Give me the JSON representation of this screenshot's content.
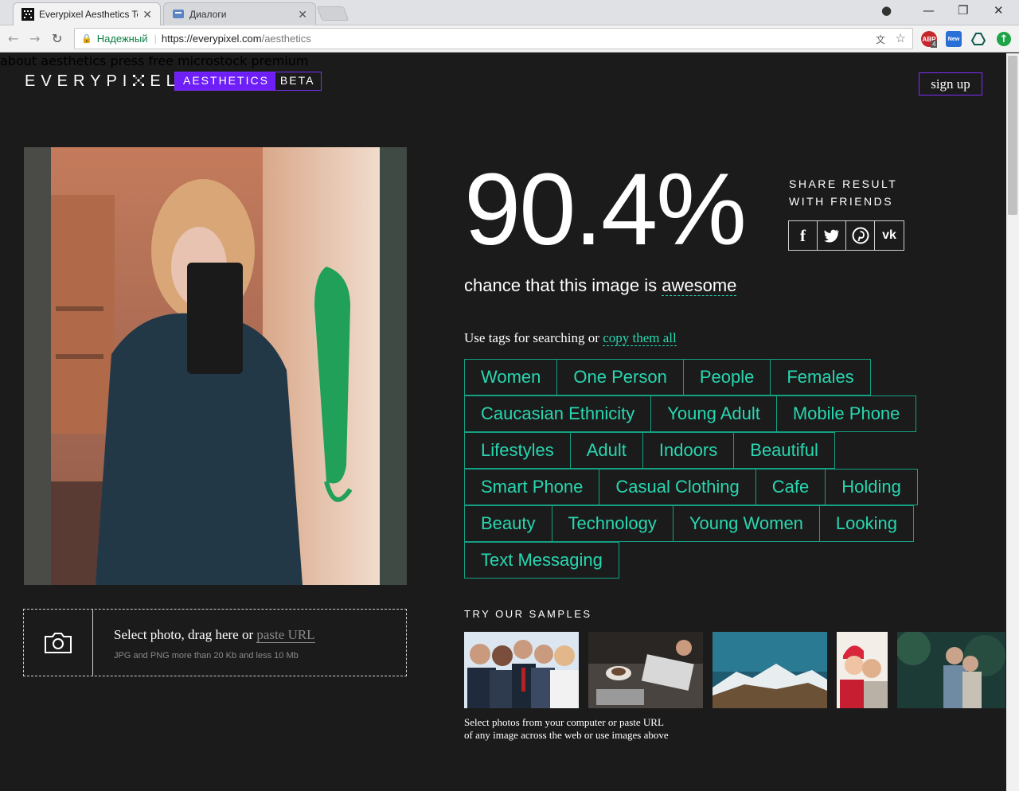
{
  "browser": {
    "tabs": [
      {
        "title": "Everypixel Aesthetics Tes",
        "active": true
      },
      {
        "title": "Диалоги",
        "active": false
      }
    ],
    "address": {
      "secure_label": "Надежный",
      "url_host": "https://everypixel.com",
      "url_path": "/aesthetics"
    },
    "extensions": [
      {
        "name": "adblock-icon",
        "label": "ABP",
        "badge": "4"
      },
      {
        "name": "new-extension-icon",
        "label": "New"
      }
    ]
  },
  "header": {
    "logo_left": "EVERYPI",
    "logo_right": "EL",
    "badge_main": "AESTHETICS",
    "badge_beta": "BETA",
    "nav": [
      "about",
      "aesthetics",
      "press",
      "free",
      "microstock",
      "premium"
    ],
    "signup": "sign up"
  },
  "result": {
    "score": "90.4%",
    "share_line1": "SHARE RESULT",
    "share_line2": "WITH FRIENDS",
    "social": [
      {
        "name": "facebook-icon",
        "glyph": "f"
      },
      {
        "name": "twitter-icon",
        "glyph": "t"
      },
      {
        "name": "pinterest-icon",
        "glyph": "p"
      },
      {
        "name": "vk-icon",
        "glyph": "vk"
      }
    ],
    "chance_prefix": "chance that this image is",
    "chance_word": "awesome"
  },
  "tags_section": {
    "intro": "Use tags for searching or",
    "copy_link": "copy them all",
    "rows": [
      [
        "Women",
        "One Person",
        "People",
        "Females"
      ],
      [
        "Caucasian Ethnicity",
        "Young Adult",
        "Mobile Phone"
      ],
      [
        "Lifestyles",
        "Adult",
        "Indoors",
        "Beautiful"
      ],
      [
        "Smart Phone",
        "Casual Clothing",
        "Cafe",
        "Holding"
      ],
      [
        "Beauty",
        "Technology",
        "Young Women",
        "Looking"
      ],
      [
        "Text Messaging"
      ]
    ]
  },
  "upload": {
    "prompt": "Select photo, drag here or",
    "paste_url": "paste URL",
    "hint": "JPG and PNG more than 20 Kb and less 10 Mb"
  },
  "samples": {
    "heading": "TRY OUR SAMPLES",
    "note_line1": "Select photos from your computer or paste URL",
    "note_line2": "of any image across the web or use images above"
  },
  "colors": {
    "accent_purple": "#7b2ff7",
    "tag_green": "#28d7b0",
    "background": "#1b1b1b"
  }
}
